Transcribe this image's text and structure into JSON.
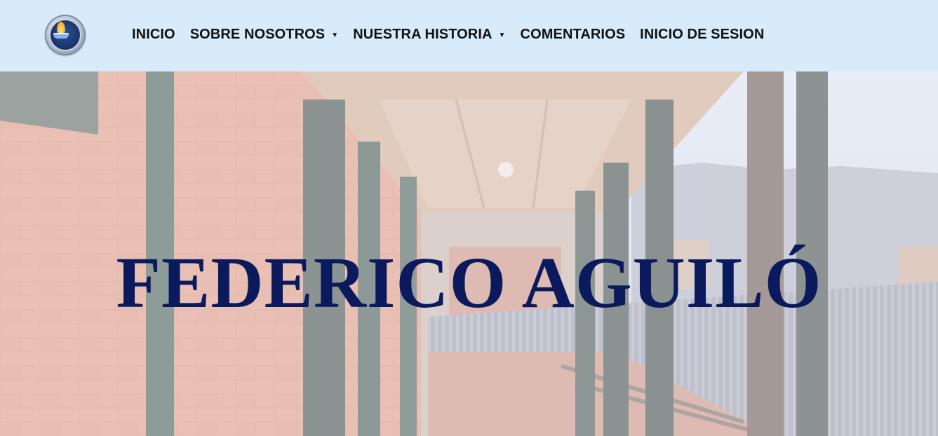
{
  "header": {
    "logo_icon": "school-emblem-icon",
    "background_color": "#d7ebfb",
    "nav": [
      {
        "label": "INICIO",
        "has_dropdown": false
      },
      {
        "label": "SOBRE NOSOTROS",
        "has_dropdown": true
      },
      {
        "label": "NUESTRA HISTORIA",
        "has_dropdown": true
      },
      {
        "label": "COMENTARIOS",
        "has_dropdown": false
      },
      {
        "label": "INICIO DE SESION",
        "has_dropdown": false
      }
    ],
    "dropdown_glyph": "▼"
  },
  "hero": {
    "title": "FEDERICO AGUILÓ",
    "title_color": "#0a1a5c"
  }
}
